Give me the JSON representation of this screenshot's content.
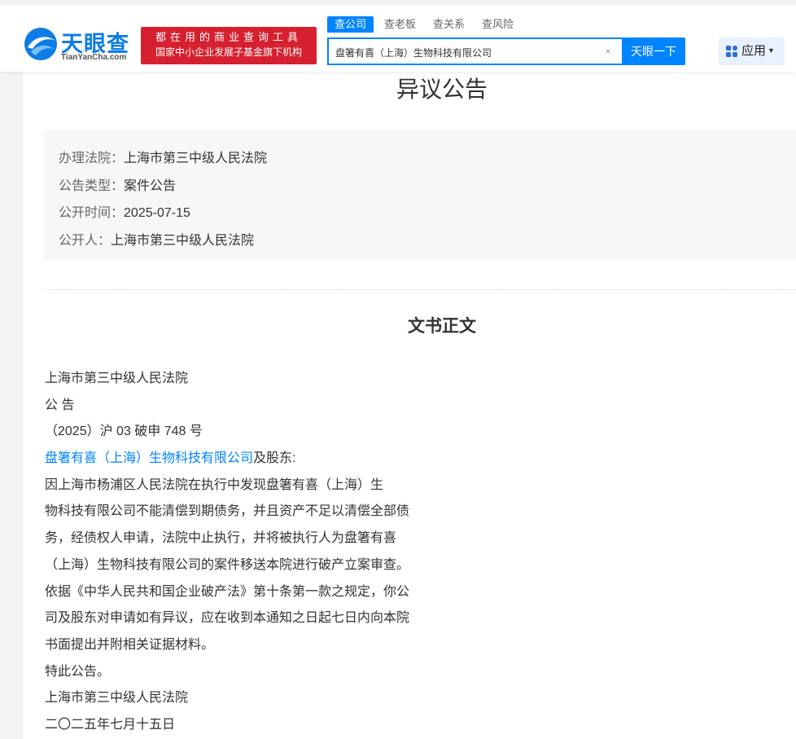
{
  "header": {
    "logo": {
      "name_cn": "天眼查",
      "domain_text": "TianYanCha.com"
    },
    "slogan": {
      "line1": "都在用的商业查询工具",
      "line2": "国家中小企业发展子基金旗下机构"
    },
    "tabs": [
      {
        "label": "查公司",
        "active": true
      },
      {
        "label": "查老板",
        "active": false
      },
      {
        "label": "查关系",
        "active": false
      },
      {
        "label": "查风险",
        "active": false
      }
    ],
    "search": {
      "value": "盘箸有喜（上海）生物科技有限公司",
      "button_label": "天眼一下",
      "clear_icon": "×"
    },
    "app_button": {
      "label": "应用",
      "icon": "grid-icon",
      "caret": "▾"
    }
  },
  "notice": {
    "title": "异议公告",
    "info": [
      {
        "key": "办理法院：",
        "value": "上海市第三中级人民法院"
      },
      {
        "key": "公告类型：",
        "value": "案件公告"
      },
      {
        "key": "公开时间：",
        "value": "2025-07-15"
      },
      {
        "key": "公开人：",
        "value": "上海市第三中级人民法院"
      }
    ],
    "section_title": "文书正文",
    "body": {
      "line1": "上海市第三中级人民法院",
      "line2": "公 告",
      "line3": "（2025）沪 03 破申 748 号",
      "company_link": "盘箸有喜（上海）生物科技有限公司",
      "line4_suffix": "及股东:",
      "line5": "因上海市杨浦区人民法院在执行中发现盘箸有喜（上海）生",
      "line6": "物科技有限公司不能清偿到期债务，并且资产不足以清偿全部债",
      "line7": "务，经债权人申请，法院中止执行，并将被执行人为盘箸有喜",
      "line8": "（上海）生物科技有限公司的案件移送本院进行破产立案审查。",
      "line9": "依据《中华人民共和国企业破产法》第十条第一款之规定，你公",
      "line10": "司及股东对申请如有异议，应在收到本通知之日起七日内向本院",
      "line11": "书面提出并附相关证据材料。",
      "line12": "特此公告。",
      "line13": "上海市第三中级人民法院",
      "line14": "二〇二五年七月十五日"
    }
  },
  "colors": {
    "brand_blue": "#0084ff",
    "logo_blue": "#0d7ce4",
    "slogan_red": "#d6202f",
    "link_blue": "#0084ff"
  }
}
